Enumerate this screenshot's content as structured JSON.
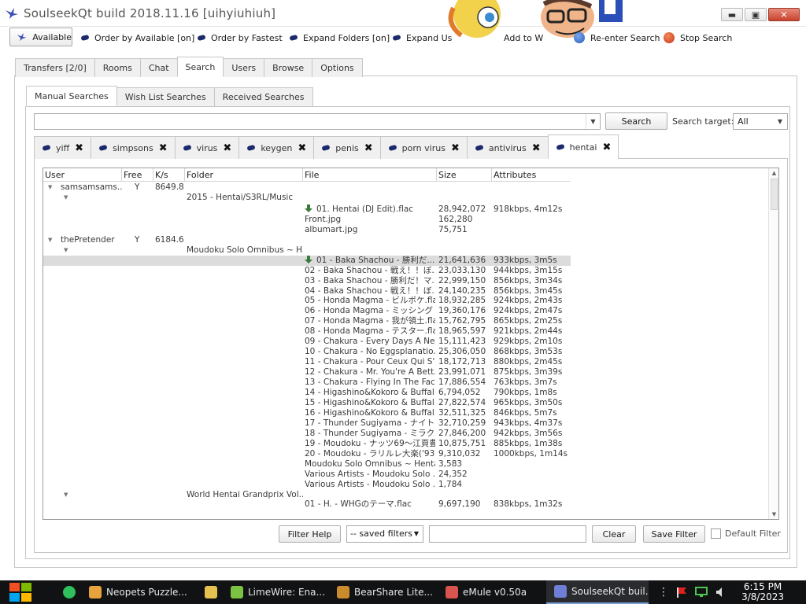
{
  "window": {
    "title": "SoulseekQt build 2018.11.16 [uihyiuhiuh]",
    "minimize": "▬",
    "maximize": "▣",
    "close": "✕"
  },
  "toolbar": {
    "available": "Available",
    "order_available": "Order by Available [on]",
    "order_fastest": "Order by Fastest",
    "expand_folders": "Expand Folders [on]",
    "expand_users": "Expand Us",
    "add_to": "Add to W",
    "reenter": "Re-enter Search",
    "stop": "Stop Search"
  },
  "tabs": [
    "Transfers [2/0]",
    "Rooms",
    "Chat",
    "Search",
    "Users",
    "Browse",
    "Options"
  ],
  "active_tab": "Search",
  "subtabs": [
    "Manual Searches",
    "Wish List Searches",
    "Received Searches"
  ],
  "search": {
    "query": "",
    "button": "Search",
    "target_label": "Search target:",
    "target_value": "All"
  },
  "query_tabs": [
    "yiff",
    "simpsons",
    "virus",
    "keygen",
    "penis",
    "porn virus",
    "antivirus",
    "hentai"
  ],
  "active_query": "hentai",
  "columns": [
    "User",
    "Free",
    "K/s",
    "Folder",
    "File",
    "Size",
    "Attributes"
  ],
  "results": {
    "users": [
      {
        "user": "samsamsams...",
        "free": "Y",
        "speed": "8649.8",
        "folders": [
          {
            "folder": "2015 - Hentai/S3RL/Music",
            "files": [
              {
                "file": "01. Hentai (DJ Edit).flac",
                "size": "28,942,072",
                "attr": "918kbps, 4m12s",
                "dl": true
              },
              {
                "file": "Front.jpg",
                "size": "162,280",
                "attr": ""
              },
              {
                "file": "albumart.jpg",
                "size": "75,751",
                "attr": ""
              }
            ]
          }
        ]
      },
      {
        "user": "thePretender",
        "free": "Y",
        "speed": "6184.6",
        "folders": [
          {
            "folder": "Moudoku Solo Omnibus ~ H...",
            "files": [
              {
                "file": "01 - Baka Shachou - 勝利だ...",
                "size": "21,641,636",
                "attr": "933kbps, 3m5s",
                "dl": true,
                "selected": true
              },
              {
                "file": "02 - Baka Shachou - 戦え！！ぼ...",
                "size": "23,033,130",
                "attr": "944kbps, 3m15s"
              },
              {
                "file": "03 - Baka Shachou - 勝利だ！マ...",
                "size": "22,999,150",
                "attr": "856kbps, 3m34s"
              },
              {
                "file": "04 - Baka Shachou - 戦え！！ぼ...",
                "size": "24,140,235",
                "attr": "856kbps, 3m45s"
              },
              {
                "file": "05 - Honda Magma - ビルボケ.flac",
                "size": "18,932,285",
                "attr": "924kbps, 2m43s"
              },
              {
                "file": "06 - Honda Magma - ミッシング・ペ...",
                "size": "19,360,176",
                "attr": "924kbps, 2m47s"
              },
              {
                "file": "07 - Honda Magma - 我が領土.flac",
                "size": "15,762,795",
                "attr": "865kbps, 2m25s"
              },
              {
                "file": "08 - Honda Magma - テスター.flac",
                "size": "18,965,597",
                "attr": "921kbps, 2m44s"
              },
              {
                "file": "09 - Chakura - Every Days A Ne...",
                "size": "15,111,423",
                "attr": "929kbps, 2m10s"
              },
              {
                "file": "10 - Chakura - No Eggsplanatio...",
                "size": "25,306,050",
                "attr": "868kbps, 3m53s"
              },
              {
                "file": "11 - Chakura - Pour Ceux Qui S'...",
                "size": "18,172,713",
                "attr": "880kbps, 2m45s"
              },
              {
                "file": "12 - Chakura - Mr. You're A Bett...",
                "size": "23,991,071",
                "attr": "875kbps, 3m39s"
              },
              {
                "file": "13 - Chakura - Flying In The Fac...",
                "size": "17,886,554",
                "attr": "763kbps, 3m7s"
              },
              {
                "file": "14 - Higashino&Kokoro & Buffal...",
                "size": "6,794,052",
                "attr": "790kbps, 1m8s"
              },
              {
                "file": "15 - Higashino&Kokoro & Buffal...",
                "size": "27,822,574",
                "attr": "965kbps, 3m50s"
              },
              {
                "file": "16 - Higashino&Kokoro & Buffal...",
                "size": "32,511,325",
                "attr": "846kbps, 5m7s"
              },
              {
                "file": "17 - Thunder Sugiyama - ナイトコ...",
                "size": "32,710,259",
                "attr": "943kbps, 4m37s"
              },
              {
                "file": "18 - Thunder Sugiyama - ミラクル...",
                "size": "27,846,200",
                "attr": "942kbps, 3m56s"
              },
              {
                "file": "19 - Moudoku - ナッツ69～江頁豊...",
                "size": "10,875,751",
                "attr": "885kbps, 1m38s"
              },
              {
                "file": "20 - Moudoku - ラリルレ大楽('93...",
                "size": "9,310,032",
                "attr": "1000kbps, 1m14s"
              },
              {
                "file": "Moudoku Solo Omnibus ~ Henta...",
                "size": "3,583",
                "attr": ""
              },
              {
                "file": "Various Artists - Moudoku Solo ...",
                "size": "24,352",
                "attr": ""
              },
              {
                "file": "Various Artists - Moudoku Solo ...",
                "size": "1,784",
                "attr": ""
              }
            ]
          },
          {
            "folder": "World Hentai Grandprix Vol....",
            "files": [
              {
                "file": "01 - H. - WHGのテーマ.flac",
                "size": "9,697,190",
                "attr": "838kbps, 1m32s"
              }
            ]
          }
        ]
      }
    ]
  },
  "filter": {
    "help": "Filter Help",
    "saved": "-- saved filters",
    "value": "",
    "clear": "Clear",
    "save": "Save Filter",
    "default_label": "Default Filter"
  },
  "taskbar": {
    "apps": [
      {
        "label": "Neopets Puzzle...",
        "color": "#e8a33c"
      },
      {
        "label": "",
        "color": "#e7c14f"
      },
      {
        "label": "LimeWire: Ena...",
        "color": "#7cc242"
      },
      {
        "label": "BearShare Lite...",
        "color": "#c98b2b"
      },
      {
        "label": "eMule v0.50a",
        "color": "#d9534f"
      },
      {
        "label": "SoulseekQt buil...",
        "color": "#6f7fd6"
      }
    ],
    "time": "6:15 PM",
    "date": "3/8/2023"
  },
  "colors": {
    "accent_dot": "#1b2a6b",
    "selection": "#dcdcdc",
    "taskbar": "#111214"
  }
}
